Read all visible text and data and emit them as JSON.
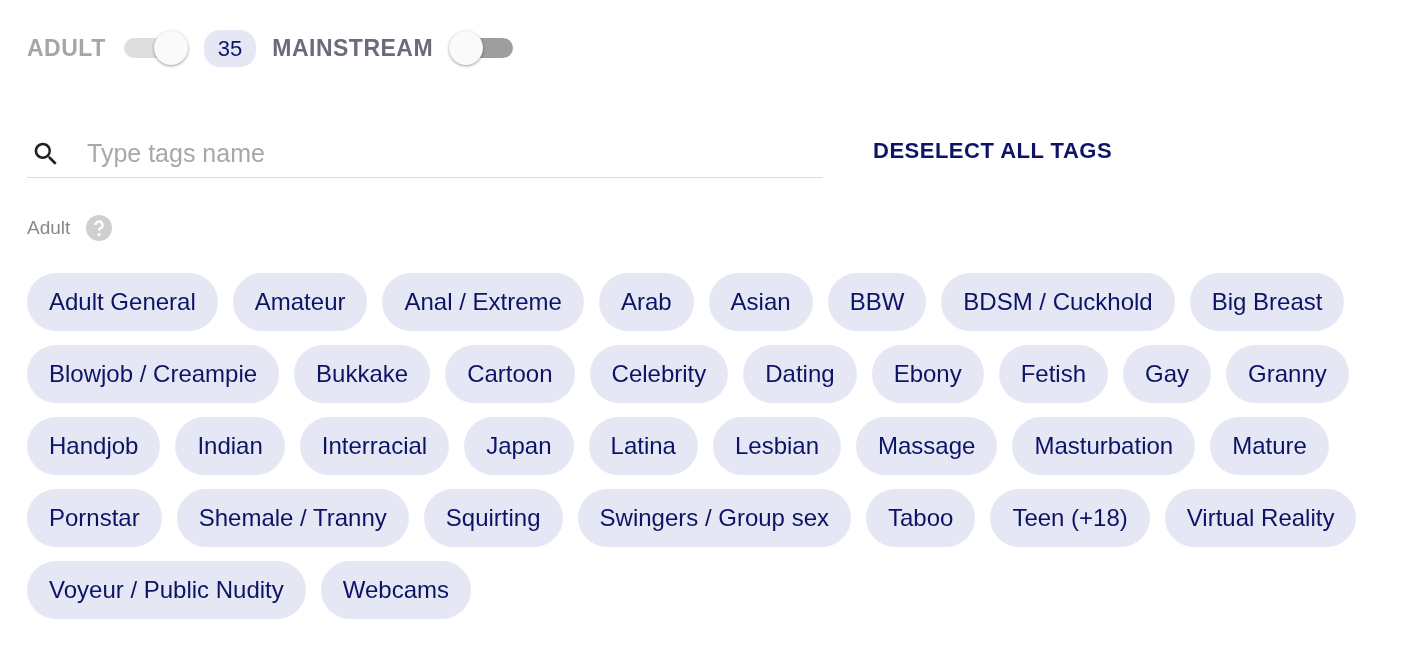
{
  "filters": [
    {
      "kind": "switch",
      "label": "ADULT",
      "on": true,
      "disabled": true
    },
    {
      "kind": "count",
      "text": "35"
    },
    {
      "kind": "switch",
      "label": "MAINSTREAM",
      "on": false,
      "disabled": false
    }
  ],
  "search": {
    "placeholder": "Type tags name"
  },
  "deselect_button": "DESELECT ALL TAGS",
  "section": {
    "title": "Adult",
    "tags": [
      "Adult General",
      "Amateur",
      "Anal / Extreme",
      "Arab",
      "Asian",
      "BBW",
      "BDSM / Cuckhold",
      "Big Breast",
      "Blowjob / Creampie",
      "Bukkake",
      "Cartoon",
      "Celebrity",
      "Dating",
      "Ebony",
      "Fetish",
      "Gay",
      "Granny",
      "Handjob",
      "Indian",
      "Interracial",
      "Japan",
      "Latina",
      "Lesbian",
      "Massage",
      "Masturbation",
      "Mature",
      "Pornstar",
      "Shemale / Tranny",
      "Squirting",
      "Swingers / Group sex",
      "Taboo",
      "Teen (+18)",
      "Virtual Reality",
      "Voyeur / Public Nudity",
      "Webcams"
    ]
  }
}
